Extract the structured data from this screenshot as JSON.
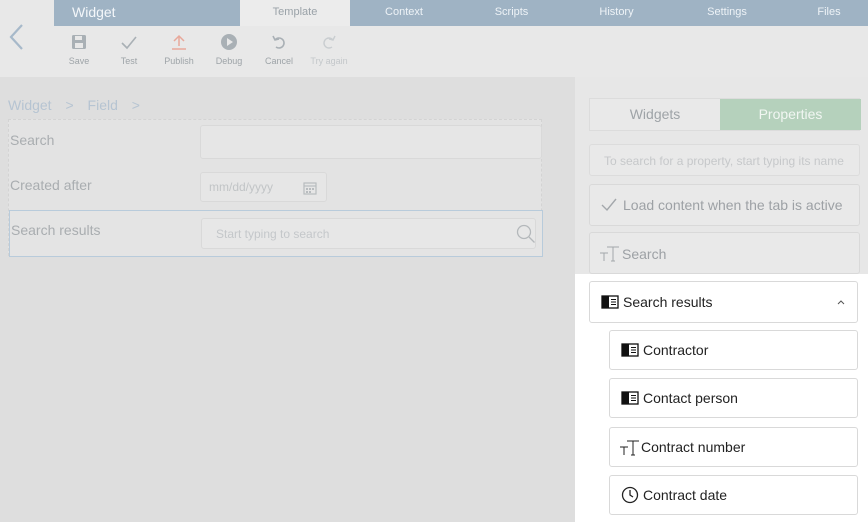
{
  "header": {
    "app_title": "Widget",
    "tabs": [
      {
        "label": "Template",
        "active": true
      },
      {
        "label": "Context"
      },
      {
        "label": "Scripts"
      },
      {
        "label": "History"
      },
      {
        "label": "Settings"
      },
      {
        "label": "Files"
      }
    ]
  },
  "toolbar": {
    "save": "Save",
    "test": "Test",
    "publish": "Publish",
    "debug": "Debug",
    "cancel": "Cancel",
    "try_again": "Try again"
  },
  "breadcrumb": [
    "Widget",
    ">",
    "Field",
    ">"
  ],
  "form": {
    "search_label": "Search",
    "created_after_label": "Created after",
    "date_placeholder": "mm/dd/yyyy",
    "search_results_label": "Search results",
    "search_placeholder": "Start typing to search"
  },
  "side": {
    "tab_widgets": "Widgets",
    "tab_properties": "Properties",
    "property_search_placeholder": "To search for a property, start typing its name",
    "load_content": "Load content when the tab is active",
    "search_item": "Search",
    "search_results_item": "Search results",
    "children": [
      "Contractor",
      "Contact person",
      "Contract number",
      "Contract date"
    ]
  },
  "colors": {
    "nav_bg": "#9fb3c4",
    "properties_tab": "#b5d1bc",
    "publish_icon": "#e8a89a"
  }
}
